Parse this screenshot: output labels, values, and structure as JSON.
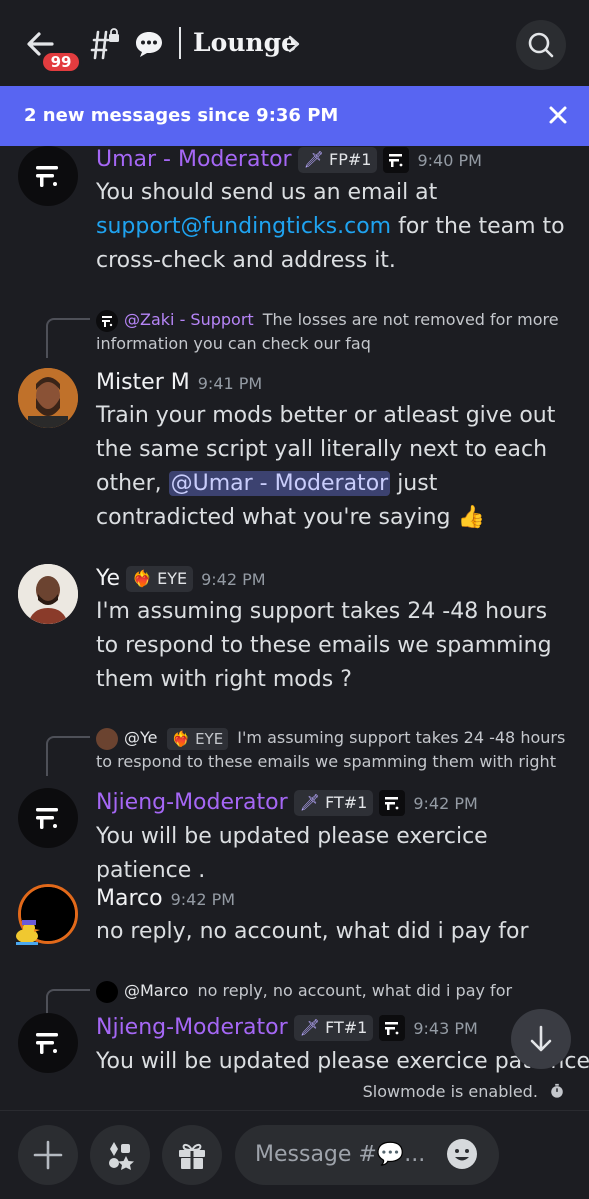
{
  "header": {
    "unread_badge": "99",
    "channel_title": "Lounge"
  },
  "new_messages_bar": {
    "text": "2 new messages since 9:36 PM"
  },
  "messages": [
    {
      "author": "Umar - Moderator",
      "tag": "FP#1",
      "time": "9:40 PM",
      "text_1": "You should send us an email  at",
      "link": "support@fundingticks.com",
      "text_2": " for the team to cross-check and address it."
    },
    {
      "reply": {
        "author": "@Zaki - Support",
        "text": "The losses are not removed for more information you can check our faq"
      },
      "author": "Mister M",
      "time": "9:41 PM",
      "text_1": "Train your mods better or atleast give out the same script yall literally next to each other, ",
      "mention": "@Umar - Moderator",
      "text_2": " just contradicted what you're saying",
      "emoji": "👍"
    },
    {
      "author": "Ye",
      "tag": "EYE",
      "time": "9:42 PM",
      "text": "I'm assuming support takes 24 -48 hours to respond to these emails we spamming them with right mods ?"
    },
    {
      "reply": {
        "author": "@Ye",
        "tag": "EYE",
        "text": "I'm assuming support takes 24 -48 hours to respond to these emails we spamming them with right"
      },
      "author": "Njieng-Moderator",
      "tag": "FT#1",
      "time": "9:42 PM",
      "text": "You will be updated please exercice patience ."
    },
    {
      "author": "Marco",
      "time": "9:42 PM",
      "text": "no reply, no account, what did i pay for"
    },
    {
      "reply": {
        "author": "@Marco",
        "text": "no reply, no account, what did i pay for"
      },
      "author": "Njieng-Moderator",
      "tag": "FT#1",
      "time": "9:43 PM",
      "text": "You will be updated please exercice patience ."
    }
  ],
  "slowmode": "Slowmode is enabled.",
  "composer": {
    "placeholder": "Message #💬..."
  },
  "icons": {
    "back": "arrow-left-icon",
    "channel": "hash-lock-icon",
    "search": "search-icon",
    "close": "close-icon",
    "scroll_down": "arrow-down-icon",
    "add": "plus-icon",
    "apps": "apps-icon",
    "gift": "gift-icon",
    "emoji": "emoji-icon",
    "timer": "stopwatch-icon"
  },
  "colors": {
    "accent": "#5865f2",
    "moderator_name": "#a567f5",
    "link": "#1fa3f0",
    "badge": "#e23c3f"
  }
}
